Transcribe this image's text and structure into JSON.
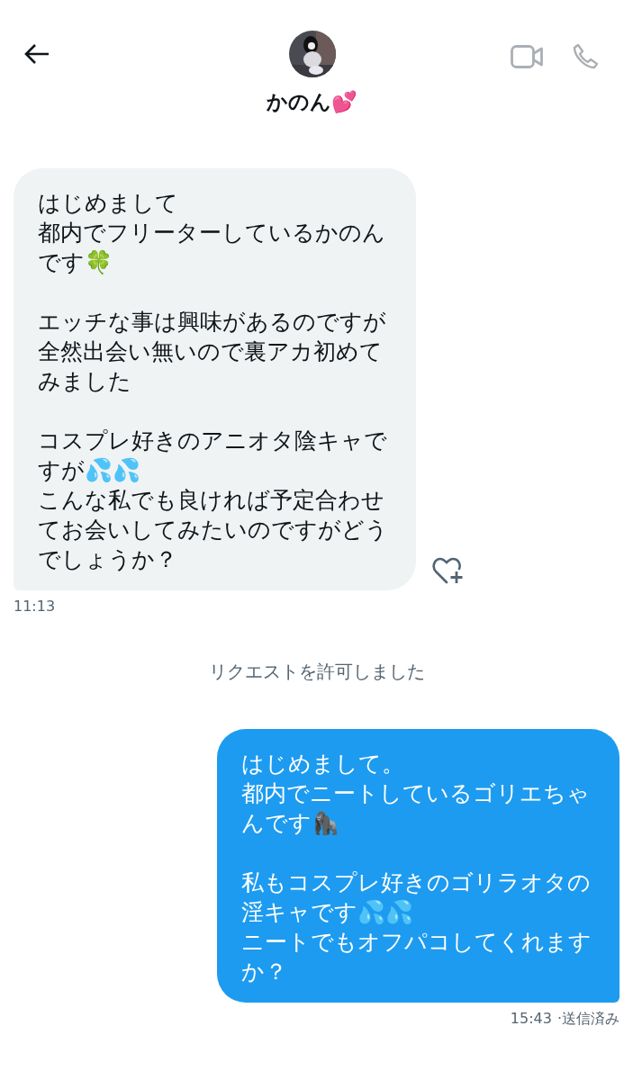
{
  "header": {
    "name": "かのん💕"
  },
  "messages": [
    {
      "kind": "received",
      "paragraphs": [
        [
          "はじめまして",
          "都内でフリーターしているかのんです🍀"
        ],
        [
          "エッチな事は興味があるのですが",
          "全然出会い無いので裏アカ初めてみました"
        ],
        [
          "コスプレ好きのアニオタ陰キャですが💦💦",
          "こんな私でも良ければ予定合わせてお会いしてみたいのですがどうでしょうか？"
        ]
      ],
      "time": "11:13"
    },
    {
      "kind": "notice",
      "text": "リクエストを許可しました"
    },
    {
      "kind": "sent",
      "paragraphs": [
        [
          "はじめまして。",
          "都内でニートしているゴリエちゃんです🦍"
        ],
        [
          "私もコスプレ好きのゴリラオタの淫キャです💦💦",
          "ニートでもオフパコしてくれますか？"
        ]
      ],
      "time": "15:43",
      "status": "·送信済み"
    }
  ]
}
